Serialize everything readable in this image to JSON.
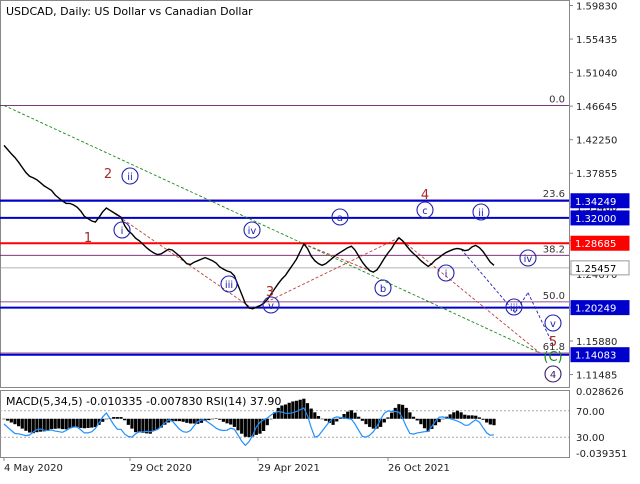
{
  "chart_data": [
    {
      "type": "line",
      "title": "USDCAD, Daily:  US Dollar vs Canadian Dollar",
      "x_ticks": [
        "4 May 2020",
        "29 Oct 2020",
        "29 Apr 2021",
        "26 Oct 2021"
      ],
      "y_ticks": [
        "1.59830",
        "1.55435",
        "1.51040",
        "1.46645",
        "1.42250",
        "1.37855",
        "1.33460",
        "1.29065",
        "1.24670",
        "1.20275",
        "1.15880",
        "1.11485"
      ],
      "ylim": [
        1.0985,
        1.6055
      ],
      "series": [
        {
          "values": [
            1.415,
            1.4095,
            1.404,
            1.399,
            1.393,
            1.386,
            1.3795,
            1.3745,
            1.3725,
            1.37,
            1.366,
            1.362,
            1.359,
            1.356,
            1.35,
            1.346,
            1.342,
            1.339,
            1.339,
            1.337,
            1.334,
            1.329,
            1.322,
            1.319,
            1.316,
            1.3145,
            1.321,
            1.328,
            1.333,
            1.33,
            1.327,
            1.324,
            1.321,
            1.31,
            1.303,
            1.299,
            1.2935,
            1.29,
            1.2855,
            1.281,
            1.277,
            1.274,
            1.272,
            1.273,
            1.276,
            1.279,
            1.278,
            1.274,
            1.27,
            1.265,
            1.26,
            1.259,
            1.262,
            1.264,
            1.266,
            1.268,
            1.266,
            1.264,
            1.261,
            1.256,
            1.253,
            1.2505,
            1.249,
            1.244,
            1.232,
            1.22,
            1.208,
            1.202,
            1.201,
            1.203,
            1.205,
            1.208,
            1.213,
            1.22,
            1.227,
            1.234,
            1.24,
            1.245,
            1.252,
            1.259,
            1.266,
            1.276,
            1.286,
            1.28,
            1.27,
            1.264,
            1.26,
            1.258,
            1.26,
            1.264,
            1.268,
            1.272,
            1.275,
            1.278,
            1.281,
            1.283,
            1.278,
            1.27,
            1.262,
            1.256,
            1.251,
            1.249,
            1.252,
            1.259,
            1.267,
            1.274,
            1.28,
            1.288,
            1.294,
            1.29,
            1.284,
            1.278,
            1.273,
            1.269,
            1.264,
            1.26,
            1.2565,
            1.26,
            1.265,
            1.268,
            1.272,
            1.275,
            1.277,
            1.279,
            1.28,
            1.279,
            1.277,
            1.278,
            1.282,
            1.284,
            1.281,
            1.276,
            1.269,
            1.262,
            1.258
          ],
          "color": "#000000"
        }
      ],
      "levels": [
        {
          "label": "0.0",
          "value": 1.4674,
          "color": "#6b1a6b"
        },
        {
          "label": "23.6",
          "value": 1.3436,
          "color": "#6b1a6b"
        },
        {
          "label": "38.2",
          "value": 1.271,
          "color": "#6b1a6b"
        },
        {
          "label": "50.0",
          "value": 1.21,
          "color": "#6b1a6b"
        },
        {
          "label": "61.8",
          "value": 1.143,
          "color": "#6b1a6b"
        }
      ],
      "price_labels": [
        {
          "text": "1.34249",
          "value": 1.34249,
          "bg": "#0000cc",
          "color": "#ffffff"
        },
        {
          "text": "1.32000",
          "value": 1.32,
          "bg": "#0000cc",
          "color": "#ffffff"
        },
        {
          "text": "1.28685",
          "value": 1.28685,
          "bg": "#ff0000",
          "color": "#ffffff"
        },
        {
          "text": "1.25457",
          "value": 1.25457,
          "bg": "#ffffff",
          "color": "#000000"
        },
        {
          "text": "1.20249",
          "value": 1.20249,
          "bg": "#0000cc",
          "color": "#ffffff"
        },
        {
          "text": "1.14083",
          "value": 1.14083,
          "bg": "#0000cc",
          "color": "#ffffff"
        }
      ],
      "annotations": [
        {
          "text": "1",
          "style": "plain",
          "color": "#a52a2a"
        },
        {
          "text": "2",
          "style": "plain",
          "color": "#a52a2a"
        },
        {
          "text": "3",
          "style": "plain",
          "color": "#a52a2a"
        },
        {
          "text": "4",
          "style": "plain",
          "color": "#a52a2a"
        },
        {
          "text": "5",
          "style": "plain",
          "color": "#a52a2a"
        },
        {
          "text": "i",
          "style": "circle",
          "color": "#2020b0"
        },
        {
          "text": "ii",
          "style": "circle",
          "color": "#2020b0"
        },
        {
          "text": "iii",
          "style": "circle",
          "color": "#2020b0"
        },
        {
          "text": "iv",
          "style": "circle",
          "color": "#2020b0"
        },
        {
          "text": "v",
          "style": "circle",
          "color": "#2020b0"
        },
        {
          "text": "a",
          "style": "circle",
          "color": "#2020b0"
        },
        {
          "text": "b",
          "style": "circle",
          "color": "#2020b0"
        },
        {
          "text": "c",
          "style": "circle",
          "color": "#2020b0"
        },
        {
          "text": "i",
          "style": "circle",
          "color": "#2020b0"
        },
        {
          "text": "ii",
          "style": "circle",
          "color": "#2020b0"
        },
        {
          "text": "iii",
          "style": "circle",
          "color": "#2020b0"
        },
        {
          "text": "iv",
          "style": "circle",
          "color": "#2020b0"
        },
        {
          "text": "v",
          "style": "circle",
          "color": "#2020b0"
        },
        {
          "text": "(C)",
          "style": "plain",
          "color": "#1a8a1a"
        },
        {
          "text": "4",
          "style": "circle",
          "color": "#3a1a6b"
        }
      ]
    },
    {
      "type": "bar",
      "title": "MACD(5,34,5) -0.010335 -0.007830 RSI(14) 37.90",
      "y_ticks": [
        "0.028626",
        "70.00",
        "30.00",
        "-0.039351"
      ],
      "ylim": [
        -0.0394,
        0.0286
      ],
      "rsi_levels": [
        70,
        30
      ]
    }
  ]
}
